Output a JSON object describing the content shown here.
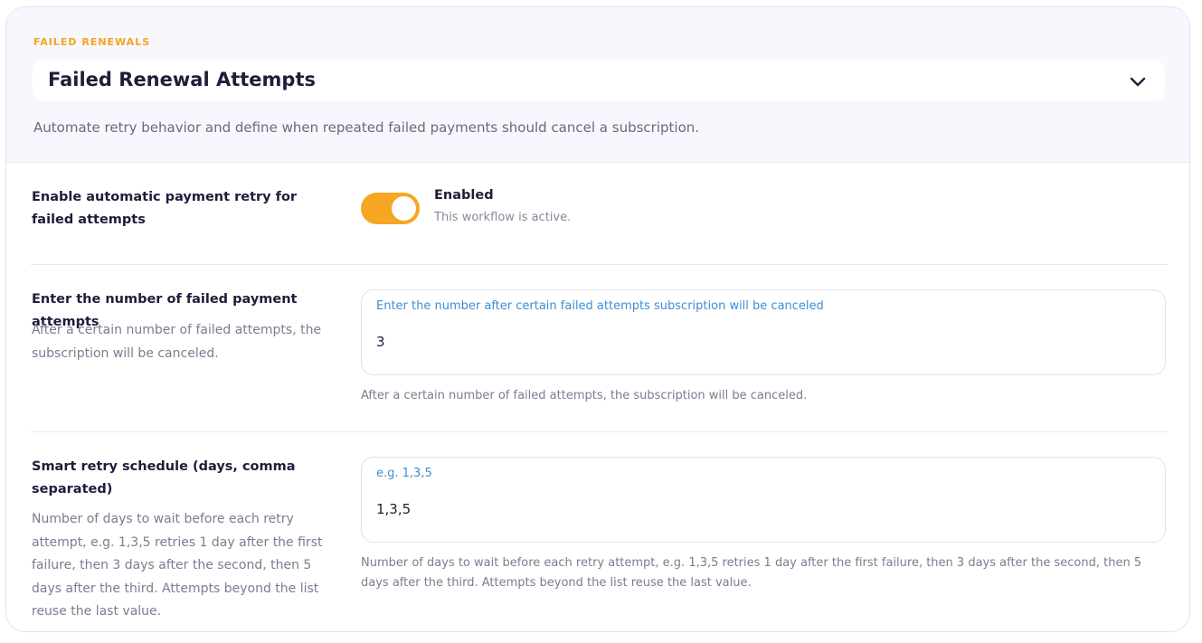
{
  "header": {
    "eyebrow": "FAILED RENEWALS",
    "title": "Failed Renewal Attempts",
    "subtitle": "Automate retry behavior and define when repeated failed payments should cancel a subscription.",
    "chevron_icon": "chevron-down-icon"
  },
  "retry_toggle": {
    "label": "Enable automatic payment retry for failed attempts",
    "state": true,
    "state_label": "Enabled",
    "state_description": "This workflow is active.",
    "accent_color": "#f5a623"
  },
  "failed_attempts": {
    "label": "Enter the number of failed payment attempts",
    "description": "After a certain number of failed attempts, the subscription will be canceled.",
    "placeholder": "Enter the number after certain failed attempts subscription will be canceled",
    "value": "3",
    "hint": "After a certain number of failed attempts, the subscription will be canceled."
  },
  "retry_schedule": {
    "label": "Smart retry schedule (days, comma separated)",
    "description": "Number of days to wait before each retry attempt, e.g. 1,3,5 retries 1 day after the first failure, then 3 days after the second, then 5 days after the third. Attempts beyond the list reuse the last value.",
    "placeholder": "e.g. 1,3,5",
    "value": "1,3,5",
    "hint": "Number of days to wait before each retry attempt, e.g. 1,3,5 retries 1 day after the first failure, then 3 days after the second, then 5 days after the third. Attempts beyond the list reuse the last value."
  }
}
